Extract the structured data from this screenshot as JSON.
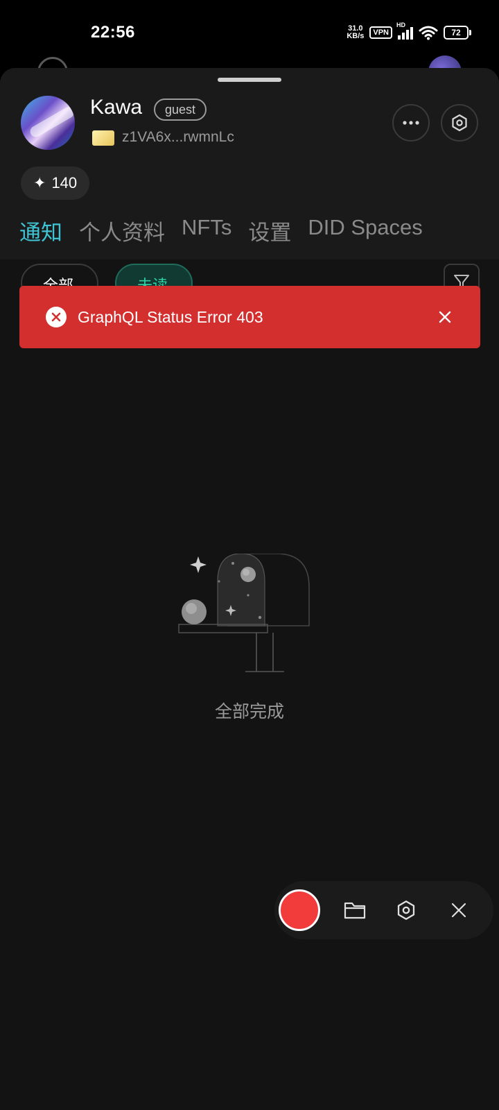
{
  "status_bar": {
    "time": "22:56",
    "net_speed_value": "31.0",
    "net_speed_unit": "KB/s",
    "vpn_label": "VPN",
    "signal_label": "HD",
    "battery": "72"
  },
  "profile": {
    "name": "Kawa",
    "role_badge": "guest",
    "did_address": "z1VA6x...rwmnLc",
    "points": "140",
    "points_icon": "sparkle-icon",
    "more_icon": "more-icon",
    "settings_icon": "hexagon-settings-icon"
  },
  "tabs": [
    {
      "label": "通知",
      "active": true
    },
    {
      "label": "个人资料",
      "active": false
    },
    {
      "label": "NFTs",
      "active": false
    },
    {
      "label": "设置",
      "active": false
    },
    {
      "label": "DID Spaces",
      "active": false
    }
  ],
  "filters": {
    "all_label": "全部",
    "unread_label": "未读"
  },
  "toast": {
    "message": "GraphQL Status Error 403",
    "color": "#d32f2f",
    "icon": "error-circle-icon"
  },
  "empty_state": {
    "text": "全部完成",
    "illustration": "mailbox-illustration"
  },
  "floating_toolbar": {
    "record_color": "#f23b3b",
    "folder_icon": "folder-icon",
    "settings_icon": "hexagon-settings-icon",
    "close_icon": "close-icon"
  },
  "colors": {
    "accent": "#3fc4d4",
    "unread_accent": "#2fd3a8",
    "background": "#131313"
  }
}
